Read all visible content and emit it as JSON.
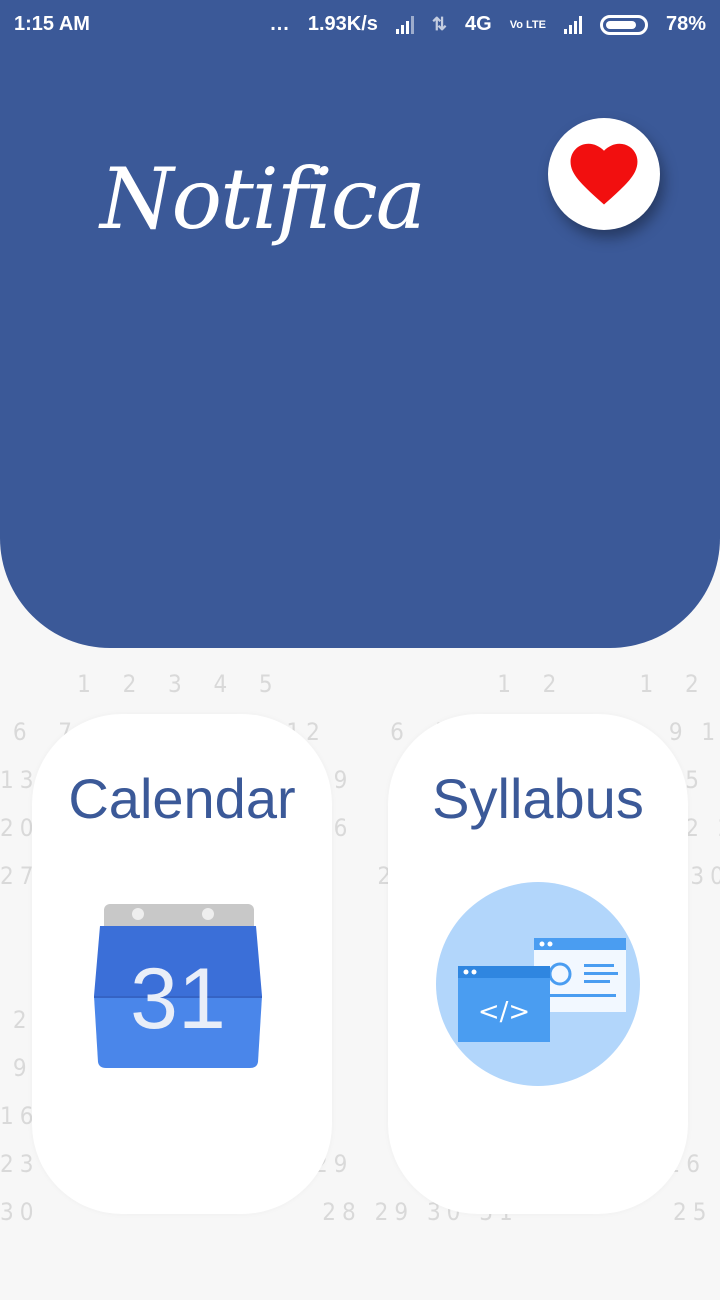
{
  "status_bar": {
    "time": "1:15 AM",
    "dots": "...",
    "speed": "1.93K/s",
    "network": "4G",
    "volte": "Vo LTE",
    "battery": "78%"
  },
  "header": {
    "logo_text": "Notifica",
    "background_color": "#3b5998",
    "favorite_icon": "heart-icon"
  },
  "cards": {
    "calendar": {
      "title": "Calendar",
      "icon": "calendar-icon",
      "icon_number": "31"
    },
    "syllabus": {
      "title": "Syllabus",
      "icon": "code-window-icon",
      "code_glyph": "</>"
    }
  },
  "background_calendar_text": "      1  2  3  4  5                 1  2      1  2  3  4  5  6  7             1  2  3  4\n 6  7  8  9 10 11 12     6  7  8  9      8  9 10 11 12 13 14          6  7  8  9 10 11\n13 14 15 16 17 18 19    13 14 15 16     15 16 17 18 19 20 21         13 14 15 16 17 18\n20 21 22 23 24 25 26    20 21 22 23     22 23 24 25 26 27 28         20 21 22 23 24 25\n27 28 29 30 31          27 28 29 30     29 30 31                     27 28 29 30 31\n\n\n 2                                   6   4                                        2\n 9                                  13   11                                        9\n16                                  20   18                                       16\n23 24 25 26 27 28 29    21 22 23 24 25 26 27    18 19 20 21 22 23 24    23 24 25 26 27\n30                      28 29 30 31            25 26 27 28 29 30        30 31"
}
